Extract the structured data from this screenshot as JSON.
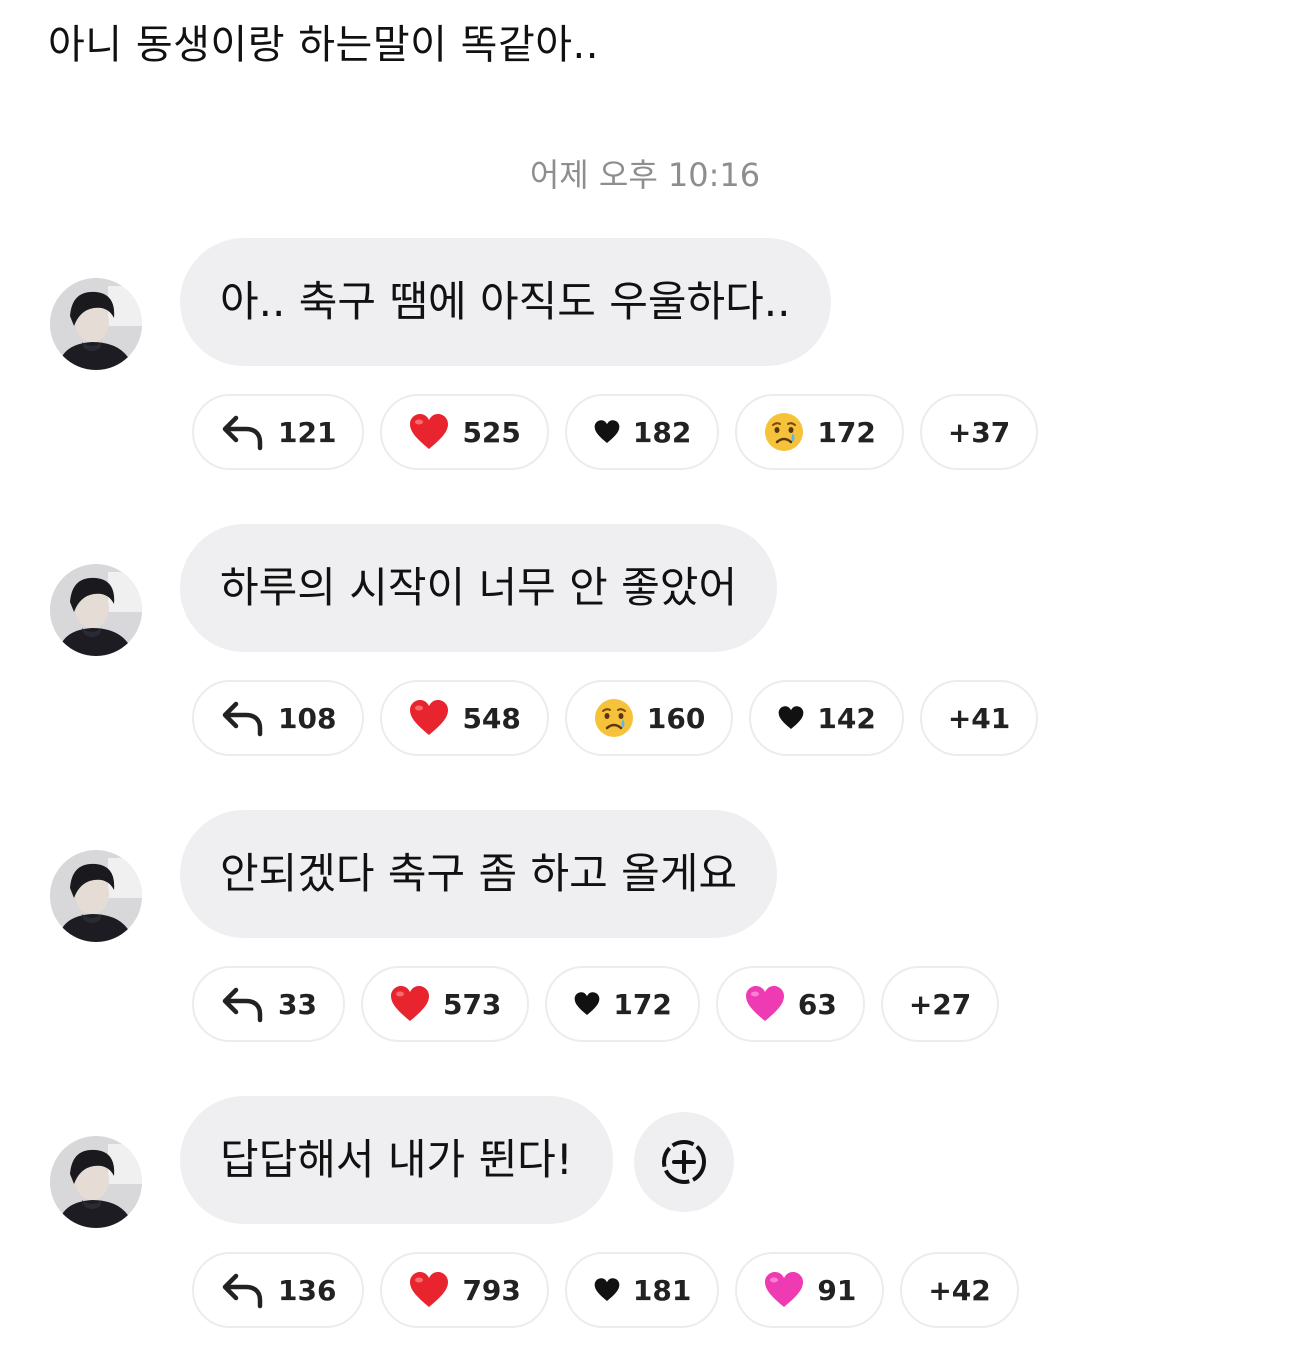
{
  "caption": "아니 동생이랑 하는말이 똑같아..",
  "timestamp": "어제 오후 10:16",
  "messages": [
    {
      "text": "아.. 축구 땜에 아직도 우울하다..",
      "reactions": [
        {
          "icon": "reply-icon",
          "count": "121"
        },
        {
          "icon": "red-heart-icon",
          "count": "525"
        },
        {
          "icon": "black-heart-icon",
          "count": "182"
        },
        {
          "icon": "crying-face-icon",
          "count": "172"
        },
        {
          "icon": "",
          "count": "+37"
        }
      ]
    },
    {
      "text": "하루의 시작이 너무 안 좋았어",
      "reactions": [
        {
          "icon": "reply-icon",
          "count": "108"
        },
        {
          "icon": "red-heart-icon",
          "count": "548"
        },
        {
          "icon": "crying-face-icon",
          "count": "160"
        },
        {
          "icon": "black-heart-icon",
          "count": "142"
        },
        {
          "icon": "",
          "count": "+41"
        }
      ]
    },
    {
      "text": "안되겠다 축구 좀 하고 올게요",
      "reactions": [
        {
          "icon": "reply-icon",
          "count": "33"
        },
        {
          "icon": "red-heart-icon",
          "count": "573"
        },
        {
          "icon": "black-heart-icon",
          "count": "172"
        },
        {
          "icon": "pink-heart-icon",
          "count": "63"
        },
        {
          "icon": "",
          "count": "+27"
        }
      ]
    },
    {
      "text": "답답해서 내가 뛴다!",
      "reactions": [
        {
          "icon": "reply-icon",
          "count": "136"
        },
        {
          "icon": "red-heart-icon",
          "count": "793"
        },
        {
          "icon": "black-heart-icon",
          "count": "181"
        },
        {
          "icon": "pink-heart-icon",
          "count": "91"
        },
        {
          "icon": "",
          "count": "+42"
        }
      ]
    }
  ],
  "colors": {
    "bubble": "#efeff1",
    "red_heart": "#e8242f",
    "pink_heart": "#ee3bb3",
    "crying_face": "#f6c23a",
    "tear": "#5fb4ec"
  }
}
